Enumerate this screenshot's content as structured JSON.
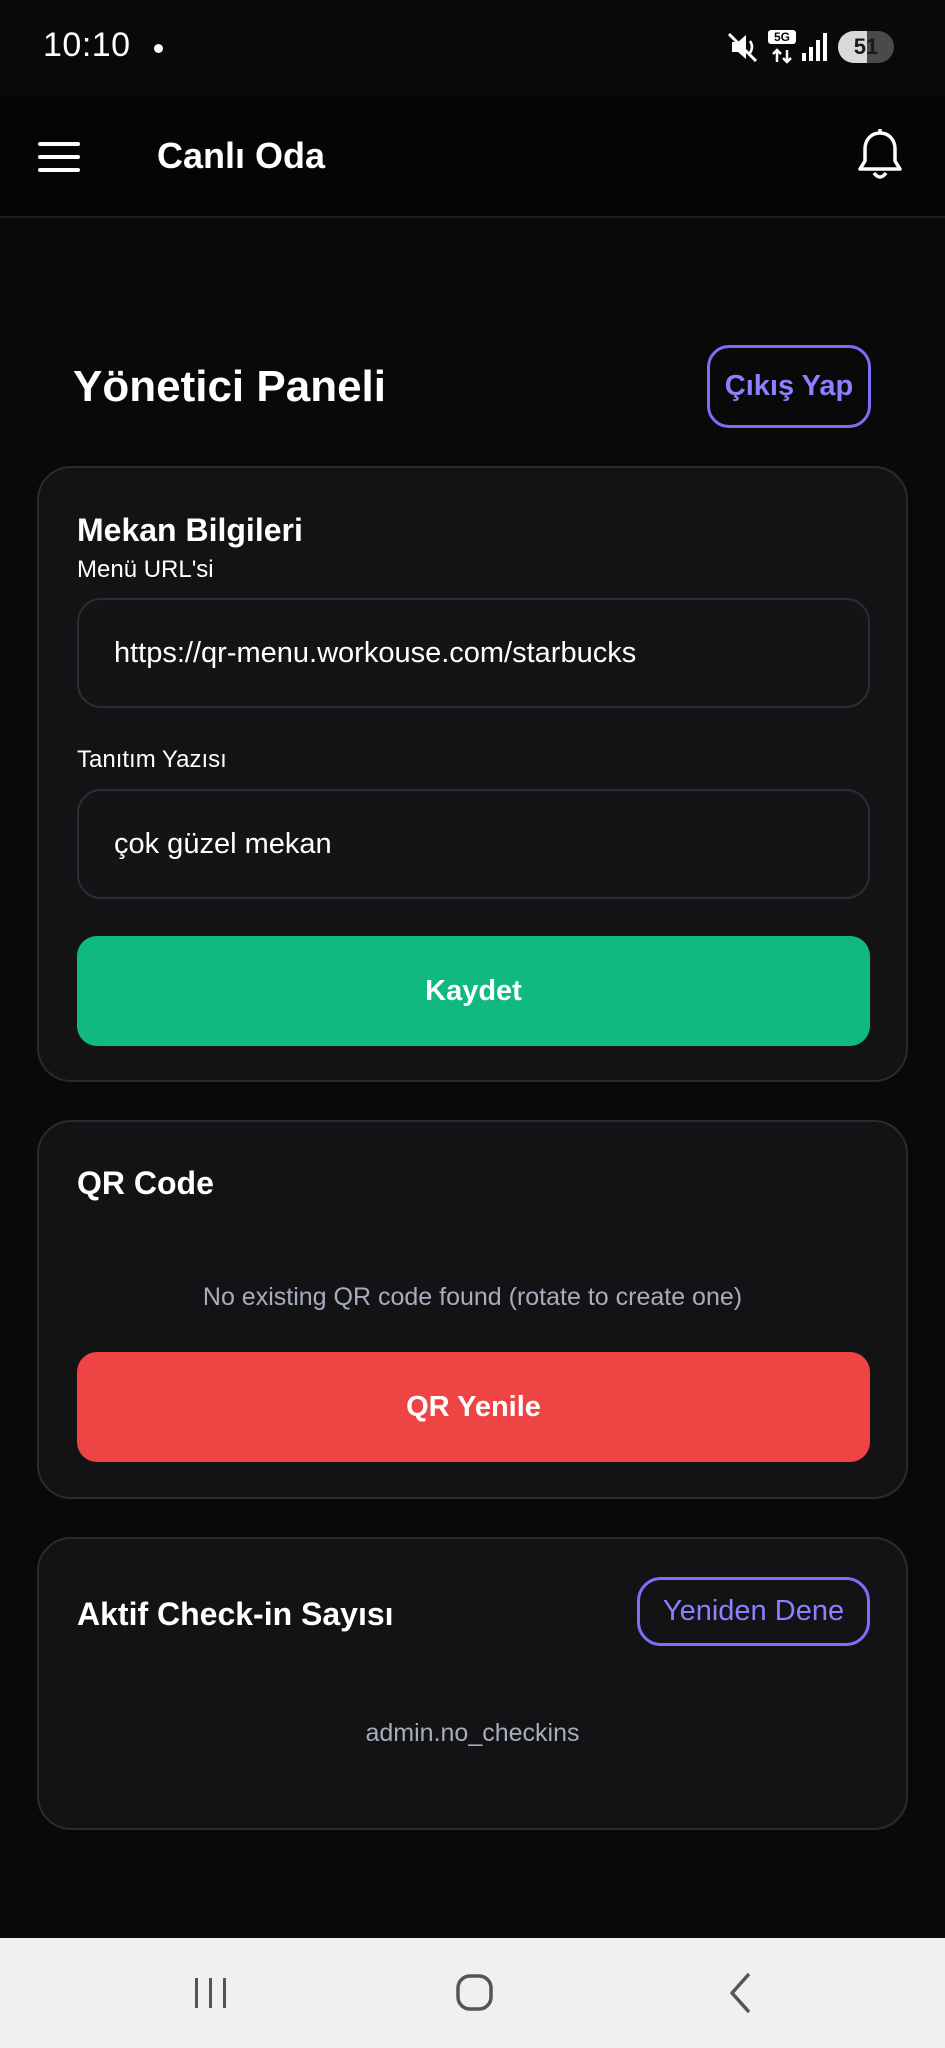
{
  "status_bar": {
    "time": "10:10",
    "network_label": "5G",
    "battery_level": "51",
    "battery_fraction": 0.51
  },
  "app_bar": {
    "title": "Canlı Oda",
    "menu_icon": "hamburger-menu-icon",
    "notification_icon": "bell-icon"
  },
  "header": {
    "title": "Yönetici Paneli",
    "logout_label": "Çıkış Yap"
  },
  "venue_card": {
    "title": "Mekan Bilgileri",
    "menu_url_label": "Menü URL'si",
    "menu_url_value": "https://qr-menu.workouse.com/starbucks",
    "intro_label": "Tanıtım Yazısı",
    "intro_value": "çok güzel mekan",
    "save_label": "Kaydet"
  },
  "qr_card": {
    "title": "QR Code",
    "empty_message": "No existing QR code found (rotate to create one)",
    "refresh_label": "QR Yenile"
  },
  "checkin_card": {
    "title": "Aktif Check-in Sayısı",
    "retry_label": "Yeniden Dene",
    "empty_message": "admin.no_checkins"
  },
  "nav_bar": {
    "recents_icon": "recents-icon",
    "home_icon": "home-icon",
    "back_icon": "back-icon"
  },
  "colors": {
    "background": "#09090a",
    "card": "#131316",
    "accent": "#7a6ff5",
    "success": "#10b981",
    "danger": "#ef4444",
    "muted_text": "#a6adbb"
  }
}
